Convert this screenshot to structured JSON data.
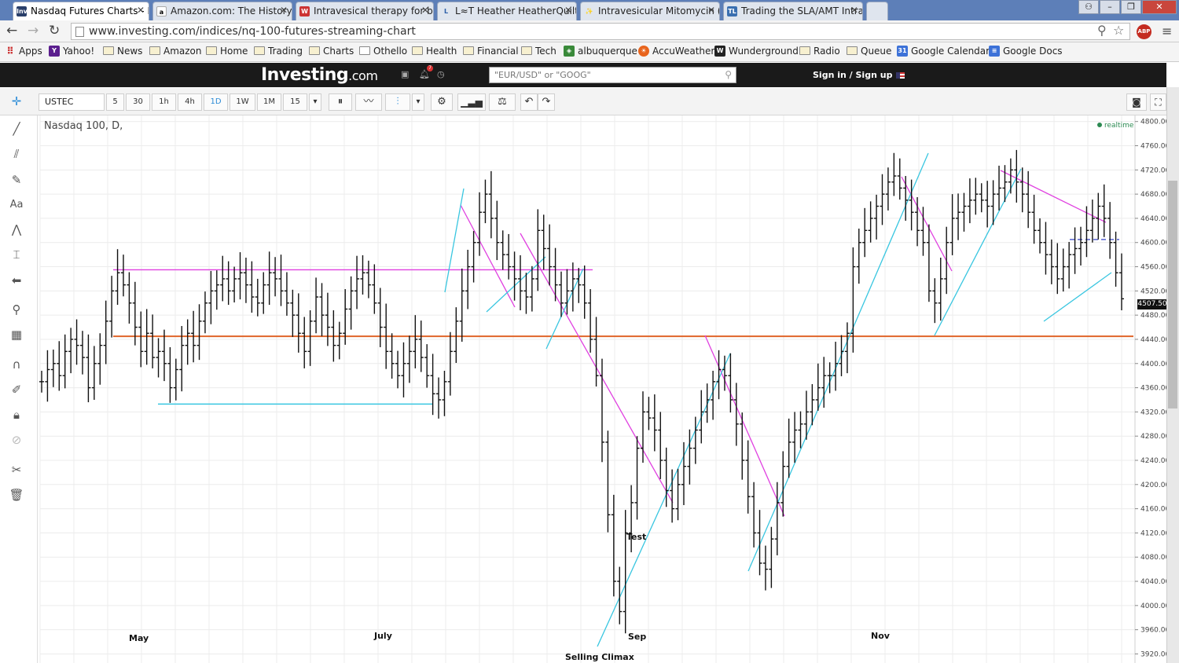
{
  "browser": {
    "tabs": [
      {
        "label": "Nasdaq Futures Charts - Ir",
        "icon": "Inv",
        "active": true
      },
      {
        "label": "Amazon.com: The History",
        "icon": "a"
      },
      {
        "label": "Intravesical therapy for bla",
        "icon": "W"
      },
      {
        "label": "L≈T Heather HeatherQuilt Cov",
        "icon": "L"
      },
      {
        "label": "Intravesicular Mitomycin (I",
        "icon": "✨"
      },
      {
        "label": "Trading the SLA/AMT Intra",
        "icon": "TL"
      }
    ],
    "url": "www.investing.com/indices/nq-100-futures-streaming-chart",
    "abp_badge": "ABP",
    "bookmarks": [
      "Apps",
      "Yahoo!",
      "News",
      "Amazon",
      "Home",
      "Trading",
      "Charts",
      "Othello",
      "Health",
      "Financial",
      "Tech",
      "albuquerque",
      "AccuWeather",
      "Wunderground",
      "Radio",
      "Queue",
      "Google Calendar",
      "Google Docs"
    ]
  },
  "site": {
    "logo": "Investing",
    "logo_suffix": ".com",
    "notif_count": "7",
    "search_placeholder": "\"EUR/USD\" or \"GOOG\"",
    "signin": "Sign in / Sign up"
  },
  "toolbar": {
    "symbol": "USTEC",
    "intervals": [
      "5",
      "30",
      "1h",
      "4h",
      "1D",
      "1W",
      "1M",
      "15"
    ],
    "active_interval": "1D"
  },
  "chart_data": {
    "type": "ohlc",
    "title": "Nasdaq 100, D,",
    "realtime": "realtime",
    "y_ticks": [
      4800,
      4760,
      4720,
      4680,
      4640,
      4600,
      4560,
      4520,
      4480,
      4440,
      4400,
      4360,
      4320,
      4280,
      4240,
      4200,
      4160,
      4120,
      4080,
      4040,
      4000,
      3960,
      3920
    ],
    "ylim": [
      3905,
      4810
    ],
    "x_labels": [
      "May",
      "July",
      "Sep",
      "Nov"
    ],
    "last_price": "4507.50",
    "annotations": [
      "Test",
      "Selling Climax"
    ],
    "horizontal_levels": [
      {
        "price": 4555,
        "color": "#e040e0"
      },
      {
        "price": 4445,
        "color": "#e0652a"
      },
      {
        "price": 4333,
        "color": "#39c6e0"
      },
      {
        "price": 4605,
        "color": "#5560d0"
      }
    ],
    "closes": [
      4370,
      4390,
      4400,
      4380,
      4420,
      4440,
      4430,
      4410,
      4360,
      4400,
      4430,
      4470,
      4520,
      4550,
      4530,
      4500,
      4460,
      4420,
      4450,
      4410,
      4420,
      4400,
      4360,
      4390,
      4430,
      4450,
      4430,
      4470,
      4500,
      4520,
      4530,
      4540,
      4520,
      4540,
      4550,
      4530,
      4510,
      4500,
      4530,
      4550,
      4540,
      4520,
      4500,
      4480,
      4450,
      4420,
      4470,
      4510,
      4480,
      4460,
      4430,
      4450,
      4490,
      4520,
      4540,
      4550,
      4530,
      4500,
      4460,
      4420,
      4400,
      4380,
      4400,
      4420,
      4440,
      4410,
      4380,
      4350,
      4340,
      4370,
      4420,
      4470,
      4520,
      4560,
      4600,
      4650,
      4680,
      4640,
      4600,
      4580,
      4560,
      4540,
      4520,
      4510,
      4540,
      4620,
      4590,
      4560,
      4530,
      4500,
      4520,
      4540,
      4530,
      4500,
      4440,
      4380,
      4270,
      4150,
      4040,
      3990,
      4120,
      4170,
      4260,
      4320,
      4310,
      4290,
      4240,
      4190,
      4160,
      4200,
      4230,
      4260,
      4290,
      4320,
      4340,
      4370,
      4390,
      4380,
      4340,
      4300,
      4240,
      4180,
      4120,
      4070,
      4060,
      4110,
      4170,
      4230,
      4270,
      4290,
      4300,
      4320,
      4340,
      4360,
      4380,
      4380,
      4400,
      4420,
      4450,
      4560,
      4600,
      4620,
      4640,
      4660,
      4680,
      4700,
      4710,
      4690,
      4670,
      4650,
      4620,
      4600,
      4520,
      4500,
      4540,
      4600,
      4640,
      4650,
      4660,
      4670,
      4680,
      4670,
      4660,
      4680,
      4690,
      4700,
      4720,
      4700,
      4680,
      4650,
      4620,
      4600,
      4580,
      4560,
      4540,
      4560,
      4580,
      4590,
      4600,
      4620,
      4640,
      4660,
      4640,
      4600,
      4550,
      4507
    ]
  }
}
